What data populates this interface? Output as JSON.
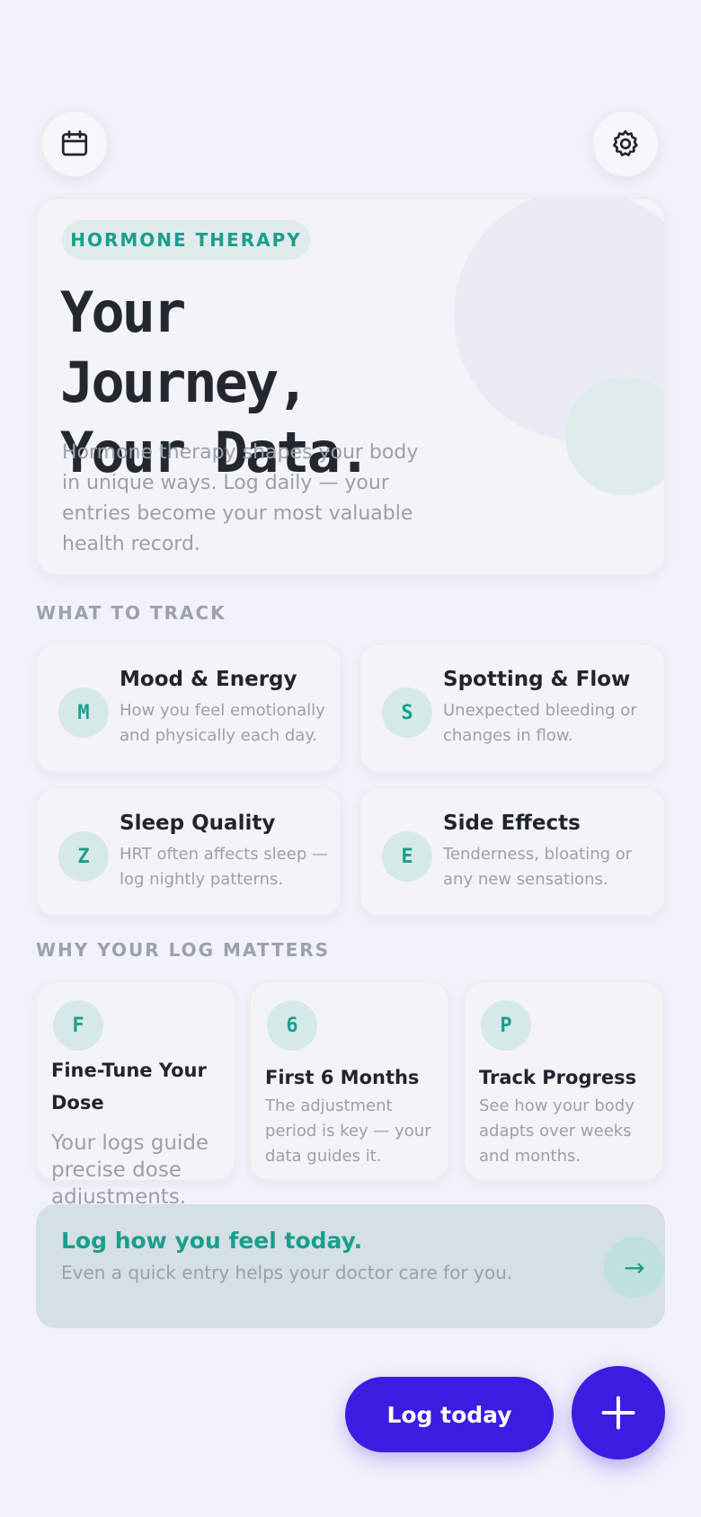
{
  "header": {
    "left_icon": "calendar-icon",
    "right_icon": "gear-icon"
  },
  "hero": {
    "tag": "HORMONE THERAPY",
    "title_line1": "Your Journey,",
    "title_line2": "Your Data.",
    "description": "Hormone therapy shapes your body in unique ways. Log daily — your entries become your most valuable health record."
  },
  "track": {
    "label": "WHAT TO TRACK",
    "items": [
      {
        "badge": "M",
        "title": "Mood & Energy",
        "desc": "How you feel emotionally and physically each day."
      },
      {
        "badge": "S",
        "title": "Spotting & Flow",
        "desc": "Unexpected bleeding or changes in flow."
      },
      {
        "badge": "Z",
        "title": "Sleep Quality",
        "desc": "HRT often affects sleep — log nightly patterns."
      },
      {
        "badge": "E",
        "title": "Side Effects",
        "desc": "Tenderness, bloating or any new sensations."
      }
    ]
  },
  "why": {
    "label": "WHY YOUR LOG MATTERS",
    "items": [
      {
        "badge": "F",
        "title": "Fine-Tune Your Dose",
        "desc": "Your logs guide precise dose adjustments."
      },
      {
        "badge": "6",
        "title": "First 6 Months",
        "desc": "The adjustment period is key — your data guides it."
      },
      {
        "badge": "P",
        "title": "Track Progress",
        "desc": "See how your body adapts over weeks and months."
      }
    ]
  },
  "cta": {
    "title": "Log how you feel today.",
    "subtitle": "Even a quick entry helps your doctor care for you.",
    "arrow": "→"
  },
  "actions": {
    "log_today": "Log today",
    "fab_icon": "plus-icon"
  },
  "colors": {
    "accent_teal": "#1a9e8d",
    "primary_purple": "#3a1de0",
    "background": "#f3f2fb"
  }
}
